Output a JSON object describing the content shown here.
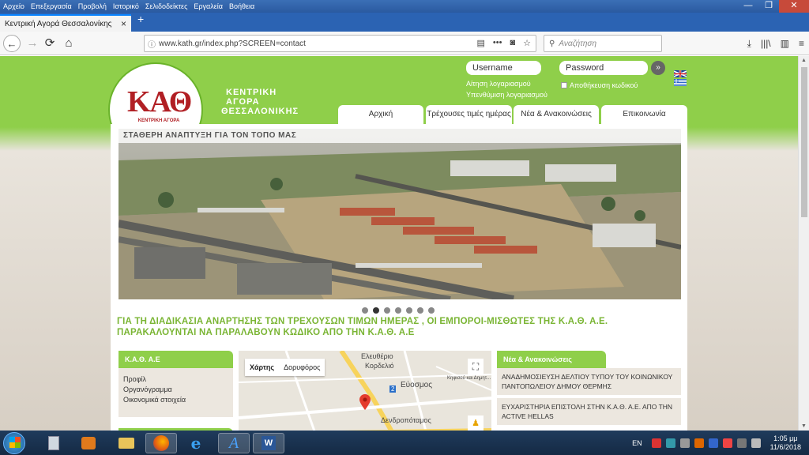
{
  "menubar": {
    "items": [
      "Αρχείο",
      "Επεξεργασία",
      "Προβολή",
      "Ιστορικό",
      "Σελιδοδείκτες",
      "Εργαλεία",
      "Βοήθεια"
    ],
    "controls": {
      "minimize": "—",
      "maximize": "❐",
      "close": "✕"
    }
  },
  "tab": {
    "title": "Κεντρική Αγορά Θεσσαλονίκης",
    "close": "×",
    "new": "+"
  },
  "toolbar": {
    "url": "www.kath.gr/index.php?SCREEN=contact",
    "search_placeholder": "Αναζήτηση",
    "back": "←",
    "forward": "→",
    "reload": "⟳",
    "home": "⌂",
    "info": "ⓘ",
    "reader": "▤",
    "more": "•••",
    "pocket": "◙",
    "bookmark": "☆",
    "download": "⤓",
    "library": "|||\\",
    "sidebar": "▥",
    "menu": "≡"
  },
  "site": {
    "logo": "ΚΑΘ",
    "logo_sub": "ΚΕΝΤΡΙΚΗ ΑΓΟΡΑ ΘΕΣΣΑΛΟΝΙΚΗΣ Α.Ε",
    "title_line1": "ΚΕΝΤΡΙΚΗ",
    "title_line2": "ΑΓΟΡΑ",
    "title_line3": "ΘΕΣΣΑΛΟΝΙΚΗΣ",
    "login": {
      "username_placeholder": "Username",
      "password_placeholder": "Password",
      "go": "»",
      "request_account": "Αίτηση λογαριασμού",
      "reminder": "Υπενθύμιση λογαριασμού",
      "remember": "Αποθήκευση κωδικού"
    },
    "nav": [
      "Αρχική",
      "Τρέχουσες τιμές ημέρας",
      "Νέα & Ανακοινώσεις",
      "Επικοινωνία"
    ],
    "hero_caption": "ΣΤΑΘΕΡΗ ΑΝΑΠΤΥΞΗ ΓΙΑ ΤΟΝ ΤΟΠΟ ΜΑΣ",
    "slider": {
      "count": 7,
      "active": 1
    },
    "notice": "ΓΙΑ ΤΗ ΔΙΑΔΙΚΑΣΙΑ ΑΝΑΡΤΗΣΗΣ ΤΩΝ ΤΡΕΧΟΥΣΩΝ ΤΙΜΩΝ ΗΜΕΡΑΣ , ΟΙ ΕΜΠΟΡΟΙ-ΜΙΣΘΩΤΕΣ ΤΗΣ Κ.Α.Θ. Α.Ε. ΠΑΡΑΚΑΛΟΥΝΤΑΙ ΝΑ ΠΑΡΑΛΑΒΟΥΝ ΚΩΔΙΚΟ ΑΠΟ ΤΗΝ Κ.Α.Θ. Α.Ε",
    "company_box": {
      "title": "Κ.Α.Θ. Α.Ε",
      "links": [
        "Προφίλ",
        "Οργανόγραμμα",
        "Οικονομικά στοιχεία"
      ]
    },
    "map": {
      "tab_map": "Χάρτης",
      "tab_satellite": "Δορυφόρος",
      "labels": [
        "Ελευθέριο",
        "Κορδελιό",
        "Εύοσμος",
        "Δενδροπόταμος",
        "2",
        "Κηφισού και Δημητ..."
      ],
      "fullscreen": "⛶",
      "pegman": "♟"
    },
    "news": {
      "title": "Νέα & Ανακοινώσεις",
      "items": [
        "ΑΝΑΔΗΜΟΣΙΕΥΣΗ ΔΕΛΤΙΟΥ ΤΥΠΟΥ ΤΟΥ ΚΟΙΝΩΝΙΚΟΥ ΠΑΝΤΟΠΩΛΕΙΟΥ ΔΗΜΟΥ ΘΕΡΜΗΣ",
        "ΕΥΧΑΡΙΣΤΗΡΙΑ ΕΠΙΣΤΟΛΗ ΣΤΗΝ Κ.Α.Θ. Α.Ε. ΑΠΟ ΤΗΝ ACTIVE HELLAS"
      ]
    }
  },
  "taskbar": {
    "apps": [
      "calculator-icon",
      "media-player-icon",
      "explorer-icon",
      "firefox-icon",
      "ie-icon",
      "font-icon",
      "word-icon"
    ],
    "lang": "EN",
    "time": "1:05 μμ",
    "date": "11/6/2018"
  }
}
